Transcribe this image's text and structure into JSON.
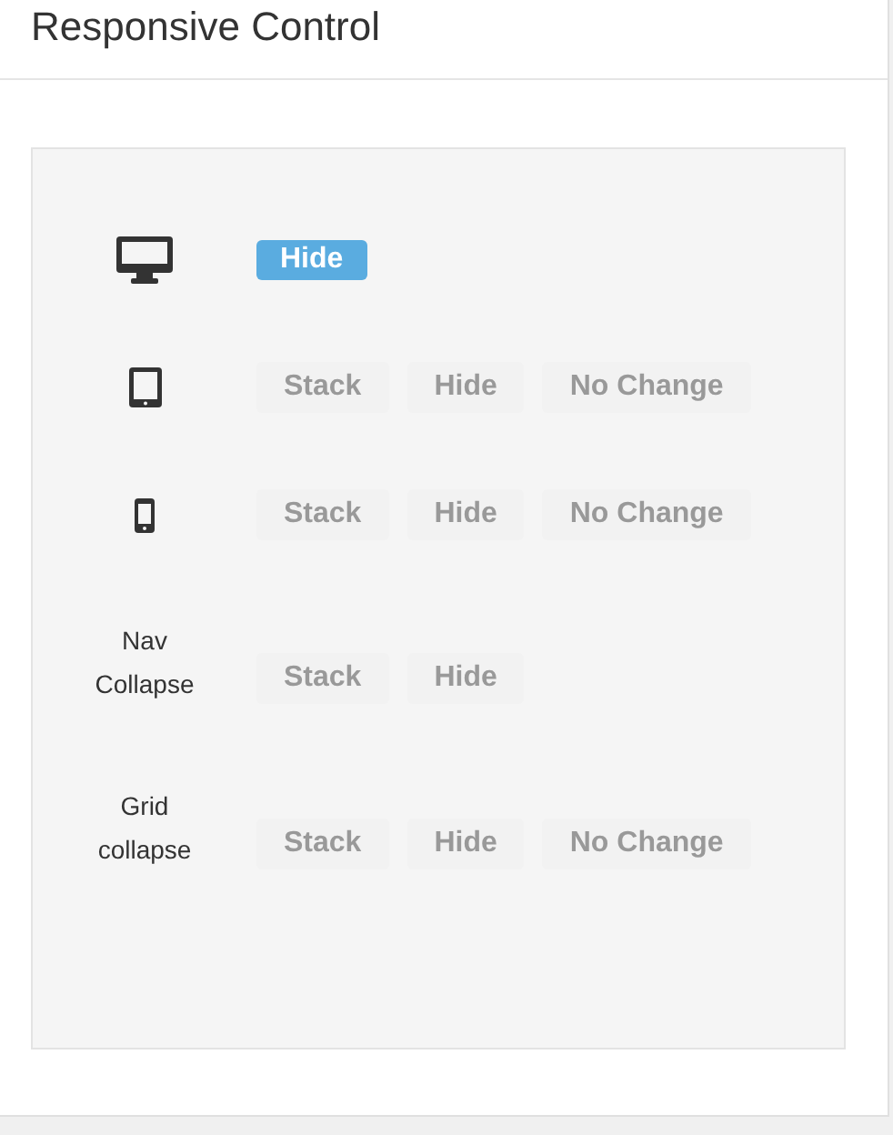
{
  "panel": {
    "title": "Responsive Control"
  },
  "rows": [
    {
      "kind": "desktop",
      "options": [
        {
          "label": "Hide",
          "selected": true
        }
      ]
    },
    {
      "kind": "tablet",
      "options": [
        {
          "label": "Stack",
          "selected": false
        },
        {
          "label": "Hide",
          "selected": false
        },
        {
          "label": "No Change",
          "selected": false
        }
      ]
    },
    {
      "kind": "phone",
      "options": [
        {
          "label": "Stack",
          "selected": false
        },
        {
          "label": "Hide",
          "selected": false
        },
        {
          "label": "No Change",
          "selected": false
        }
      ]
    },
    {
      "kind": "label",
      "label": "Nav Collapse",
      "options": [
        {
          "label": "Stack",
          "selected": false
        },
        {
          "label": "Hide",
          "selected": false
        }
      ]
    },
    {
      "kind": "label",
      "label": "Grid collapse",
      "options": [
        {
          "label": "Stack",
          "selected": false
        },
        {
          "label": "Hide",
          "selected": false
        },
        {
          "label": "No Change",
          "selected": false
        }
      ]
    }
  ]
}
